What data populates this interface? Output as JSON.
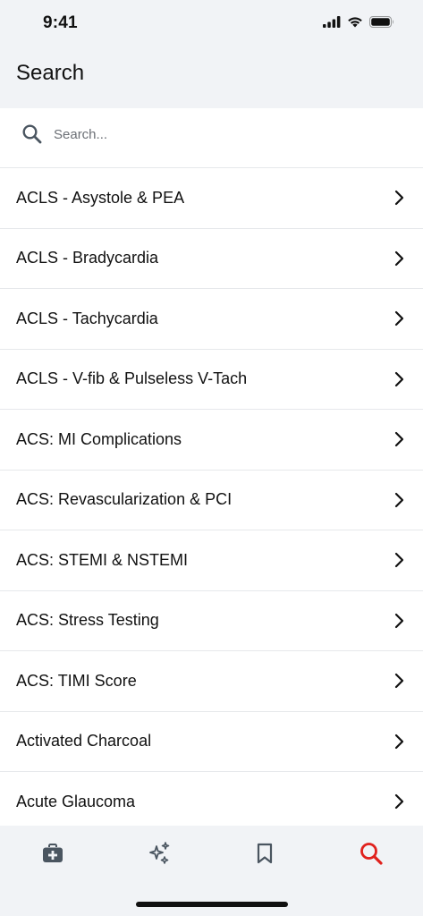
{
  "status_bar": {
    "time": "9:41"
  },
  "header": {
    "title": "Search"
  },
  "search": {
    "placeholder": "Search...",
    "value": "",
    "icon": "search-icon"
  },
  "list": {
    "items": [
      {
        "label": "ACLS - Asystole & PEA"
      },
      {
        "label": "ACLS - Bradycardia"
      },
      {
        "label": "ACLS - Tachycardia"
      },
      {
        "label": "ACLS - V-fib & Pulseless V-Tach"
      },
      {
        "label": "ACS: MI Complications"
      },
      {
        "label": "ACS: Revascularization & PCI"
      },
      {
        "label": "ACS: STEMI & NSTEMI"
      },
      {
        "label": "ACS: Stress Testing"
      },
      {
        "label": "ACS: TIMI Score"
      },
      {
        "label": "Activated Charcoal"
      },
      {
        "label": "Acute Glaucoma"
      }
    ]
  },
  "tab_bar": {
    "tabs": [
      {
        "icon": "medical-kit-icon",
        "active": false
      },
      {
        "icon": "sparkles-icon",
        "active": false
      },
      {
        "icon": "bookmark-icon",
        "active": false
      },
      {
        "icon": "search-icon",
        "active": true
      }
    ]
  },
  "colors": {
    "background": "#f1f3f6",
    "list_background": "#ffffff",
    "divider": "#e6e8eb",
    "tab_inactive": "#4a5560",
    "tab_active": "#e0211d",
    "text": "#111111"
  }
}
